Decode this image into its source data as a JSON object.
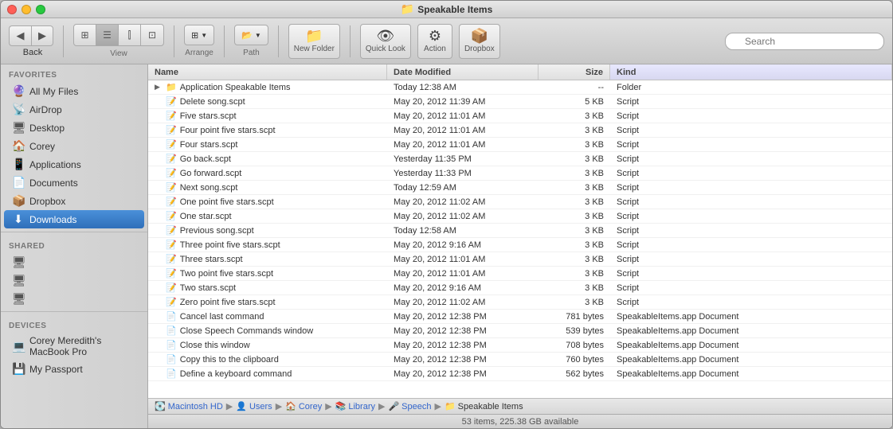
{
  "window": {
    "title": "Speakable Items",
    "folder_icon": "📁"
  },
  "toolbar": {
    "back_label": "Back",
    "view_label": "View",
    "arrange_label": "Arrange",
    "path_label": "Path",
    "new_folder_label": "New Folder",
    "quick_look_label": "Quick Look",
    "action_label": "Action",
    "dropbox_label": "Dropbox",
    "search_placeholder": "Search"
  },
  "sidebar": {
    "favorites_header": "FAVORITES",
    "shared_header": "SHARED",
    "devices_header": "DEVICES",
    "favorites": [
      {
        "id": "all-my-files",
        "label": "All My Files",
        "icon": "🔮"
      },
      {
        "id": "airdrop",
        "label": "AirDrop",
        "icon": "📡"
      },
      {
        "id": "desktop",
        "label": "Desktop",
        "icon": "🖥"
      },
      {
        "id": "corey",
        "label": "Corey",
        "icon": "🏠"
      },
      {
        "id": "applications",
        "label": "Applications",
        "icon": "📱"
      },
      {
        "id": "documents",
        "label": "Documents",
        "icon": "📄"
      },
      {
        "id": "dropbox",
        "label": "Dropbox",
        "icon": "📦"
      },
      {
        "id": "downloads",
        "label": "Downloads",
        "icon": "⬇"
      }
    ],
    "shared": [
      {
        "id": "shared-1",
        "label": "",
        "icon": "🖥"
      },
      {
        "id": "shared-2",
        "label": "",
        "icon": "🖥"
      },
      {
        "id": "shared-3",
        "label": "",
        "icon": "🖥"
      }
    ],
    "devices": [
      {
        "id": "macbook",
        "label": "Corey Meredith's MacBook Pro",
        "icon": "💻"
      },
      {
        "id": "my-passport",
        "label": "My Passport",
        "icon": "💾"
      }
    ]
  },
  "file_list": {
    "columns": [
      "Name",
      "Date Modified",
      "Size",
      "Kind"
    ],
    "rows": [
      {
        "name": "Application Speakable Items",
        "date": "Today 12:38 AM",
        "size": "--",
        "kind": "Folder",
        "type": "folder",
        "expanded": true
      },
      {
        "name": "Delete song.scpt",
        "date": "May 20, 2012 11:39 AM",
        "size": "5 KB",
        "kind": "Script",
        "type": "script"
      },
      {
        "name": "Five stars.scpt",
        "date": "May 20, 2012 11:01 AM",
        "size": "3 KB",
        "kind": "Script",
        "type": "script"
      },
      {
        "name": "Four point five stars.scpt",
        "date": "May 20, 2012 11:01 AM",
        "size": "3 KB",
        "kind": "Script",
        "type": "script"
      },
      {
        "name": "Four stars.scpt",
        "date": "May 20, 2012 11:01 AM",
        "size": "3 KB",
        "kind": "Script",
        "type": "script"
      },
      {
        "name": "Go back.scpt",
        "date": "Yesterday 11:35 PM",
        "size": "3 KB",
        "kind": "Script",
        "type": "script"
      },
      {
        "name": "Go forward.scpt",
        "date": "Yesterday 11:33 PM",
        "size": "3 KB",
        "kind": "Script",
        "type": "script"
      },
      {
        "name": "Next song.scpt",
        "date": "Today 12:59 AM",
        "size": "3 KB",
        "kind": "Script",
        "type": "script"
      },
      {
        "name": "One point five stars.scpt",
        "date": "May 20, 2012 11:02 AM",
        "size": "3 KB",
        "kind": "Script",
        "type": "script"
      },
      {
        "name": "One star.scpt",
        "date": "May 20, 2012 11:02 AM",
        "size": "3 KB",
        "kind": "Script",
        "type": "script"
      },
      {
        "name": "Previous song.scpt",
        "date": "Today 12:58 AM",
        "size": "3 KB",
        "kind": "Script",
        "type": "script"
      },
      {
        "name": "Three point five stars.scpt",
        "date": "May 20, 2012 9:16 AM",
        "size": "3 KB",
        "kind": "Script",
        "type": "script"
      },
      {
        "name": "Three stars.scpt",
        "date": "May 20, 2012 11:01 AM",
        "size": "3 KB",
        "kind": "Script",
        "type": "script"
      },
      {
        "name": "Two point five stars.scpt",
        "date": "May 20, 2012 11:01 AM",
        "size": "3 KB",
        "kind": "Script",
        "type": "script"
      },
      {
        "name": "Two stars.scpt",
        "date": "May 20, 2012 9:16 AM",
        "size": "3 KB",
        "kind": "Script",
        "type": "script"
      },
      {
        "name": "Zero point five stars.scpt",
        "date": "May 20, 2012 11:02 AM",
        "size": "3 KB",
        "kind": "Script",
        "type": "script"
      },
      {
        "name": "Cancel last command",
        "date": "May 20, 2012 12:38 PM",
        "size": "781 bytes",
        "kind": "SpeakableItems.app Document",
        "type": "doc"
      },
      {
        "name": "Close Speech Commands window",
        "date": "May 20, 2012 12:38 PM",
        "size": "539 bytes",
        "kind": "SpeakableItems.app Document",
        "type": "doc"
      },
      {
        "name": "Close this window",
        "date": "May 20, 2012 12:38 PM",
        "size": "708 bytes",
        "kind": "SpeakableItems.app Document",
        "type": "doc"
      },
      {
        "name": "Copy this to the clipboard",
        "date": "May 20, 2012 12:38 PM",
        "size": "760 bytes",
        "kind": "SpeakableItems.app Document",
        "type": "doc"
      },
      {
        "name": "Define a keyboard command",
        "date": "May 20, 2012 12:38 PM",
        "size": "562 bytes",
        "kind": "SpeakableItems.app Document",
        "type": "doc"
      }
    ]
  },
  "breadcrumb": {
    "items": [
      {
        "label": "Macintosh HD",
        "icon": "💽"
      },
      {
        "label": "Users",
        "icon": "👤"
      },
      {
        "label": "Corey",
        "icon": "🏠"
      },
      {
        "label": "Library",
        "icon": "📚"
      },
      {
        "label": "Speech",
        "icon": "🎤"
      },
      {
        "label": "Speakable Items",
        "icon": "📁"
      }
    ]
  },
  "status_bar": {
    "text": "53 items, 225.38 GB available"
  }
}
